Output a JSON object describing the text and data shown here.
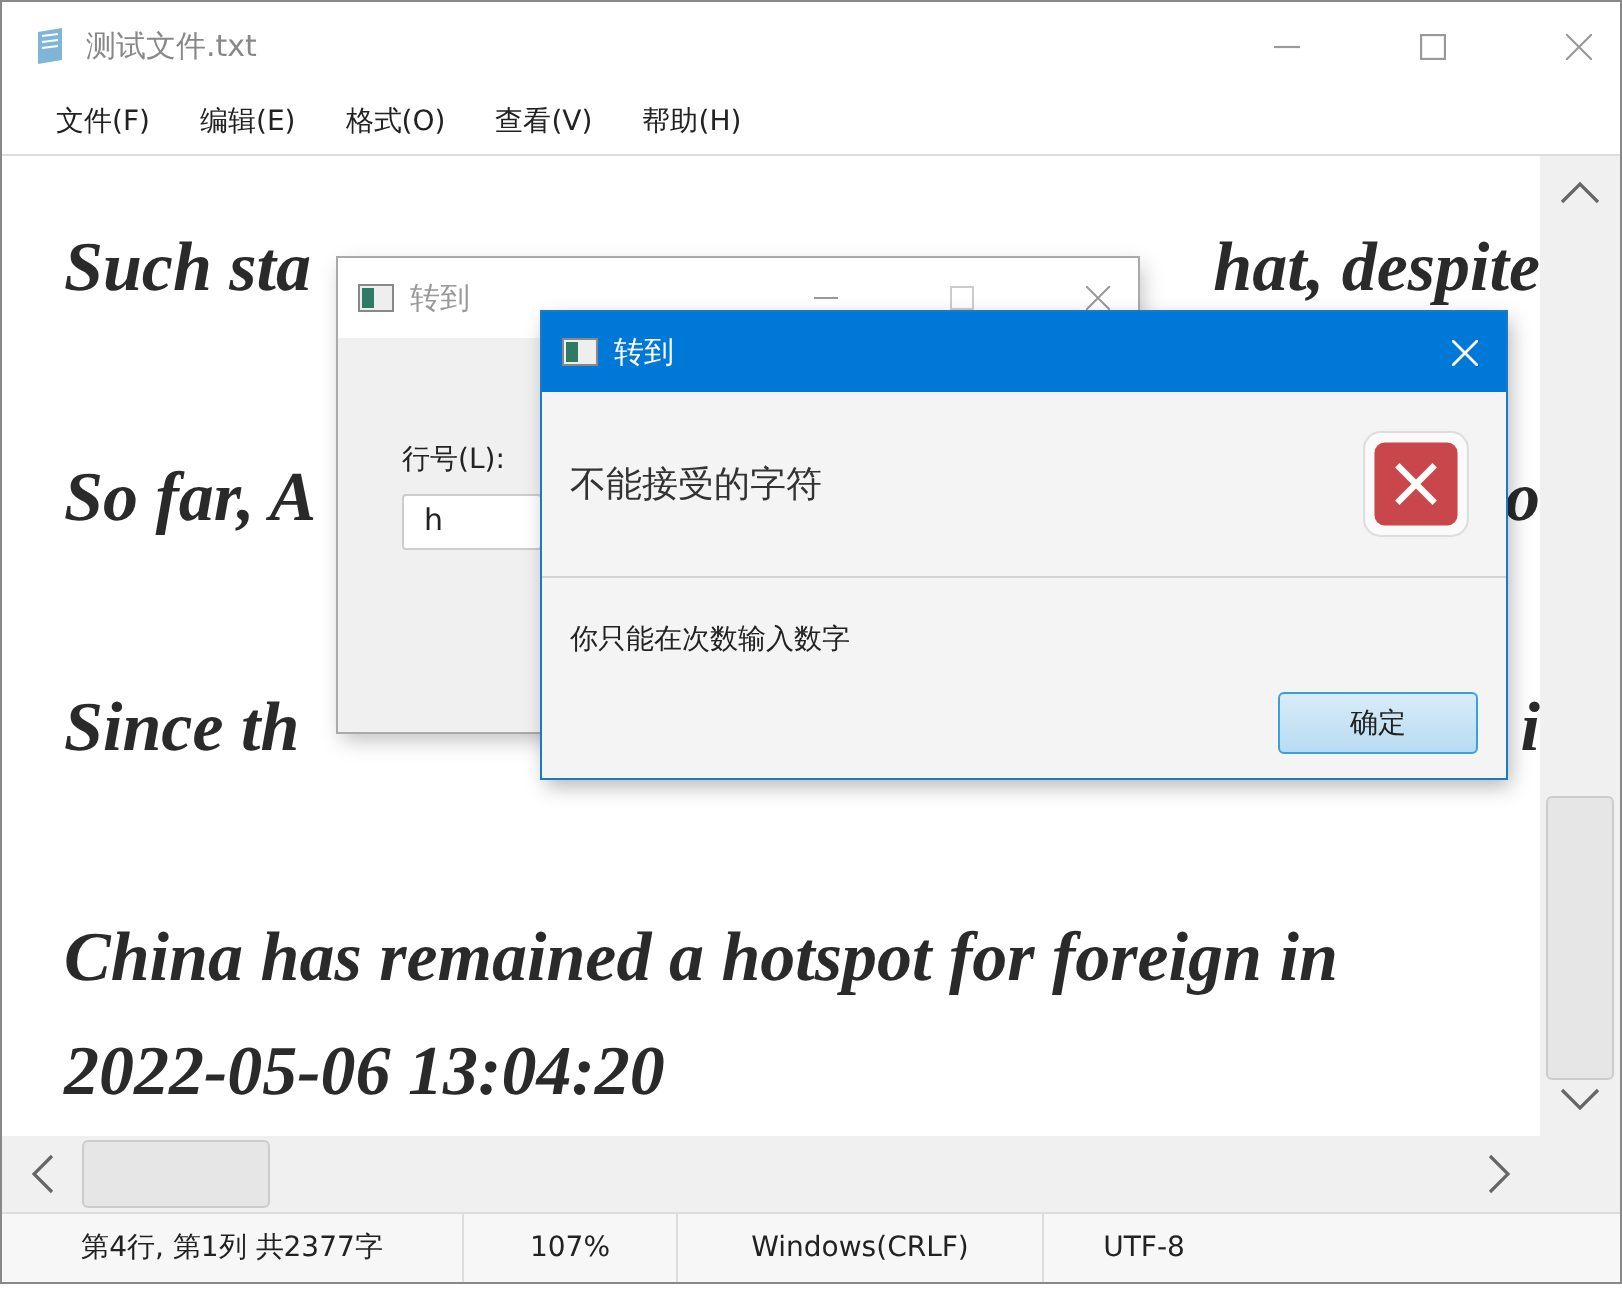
{
  "window": {
    "title": "测试文件.txt"
  },
  "menu": [
    "文件(F)",
    "编辑(E)",
    "格式(O)",
    "查看(V)",
    "帮助(H)"
  ],
  "editor": {
    "paragraphs": [
      [
        {
          "left": "Such sta",
          "right": "hat, despite"
        }
      ],
      [
        {
          "left": "So far, A",
          "right": "o"
        }
      ],
      [
        {
          "left": "Since th",
          "right": "i"
        }
      ],
      [
        {
          "left": "China has remained a hotspot for foreign in"
        },
        {
          "left": "2022-05-06 13:04:20"
        }
      ]
    ]
  },
  "status_bar": [
    "第4行, 第1列 共2377字",
    "107%",
    "Windows(CRLF)",
    "UTF-8"
  ],
  "goto_dialog": {
    "title": "转到",
    "active": false,
    "label": "行号(L):",
    "value": "h"
  },
  "error_dialog": {
    "title": "转到",
    "active": true,
    "header": "不能接受的字符",
    "message": "你只能在次数输入数字",
    "button": "确定"
  }
}
